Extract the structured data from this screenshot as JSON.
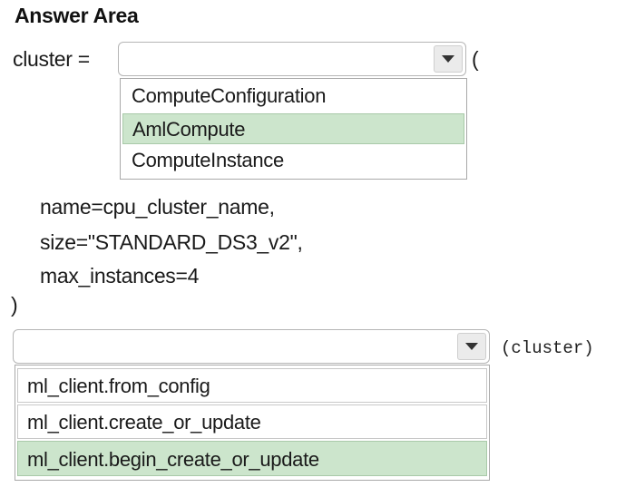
{
  "header": {
    "title": "Answer Area"
  },
  "code": {
    "cluster_assign": "cluster =",
    "open_paren": "(",
    "arg_name": "name=cpu_cluster_name,",
    "arg_size": "size=\"STANDARD_DS3_v2\",",
    "arg_max": "max_instances=4",
    "close_paren": ")",
    "call_arg": "(cluster)"
  },
  "dropdown_1": {
    "selected_value": "",
    "options": [
      "ComputeConfiguration",
      "AmlCompute",
      "ComputeInstance"
    ],
    "highlighted_option": "AmlCompute"
  },
  "dropdown_2": {
    "selected_value": "",
    "options": [
      "ml_client.from_config",
      "ml_client.create_or_update",
      "ml_client.begin_create_or_update"
    ],
    "highlighted_option": "ml_client.begin_create_or_update"
  },
  "colors": {
    "highlight": "#cce5cc",
    "select_border": "#b5b5b5",
    "arrow_bg": "#ebebeb"
  },
  "icons": {
    "dropdown_arrow": "chevron-down-icon"
  }
}
